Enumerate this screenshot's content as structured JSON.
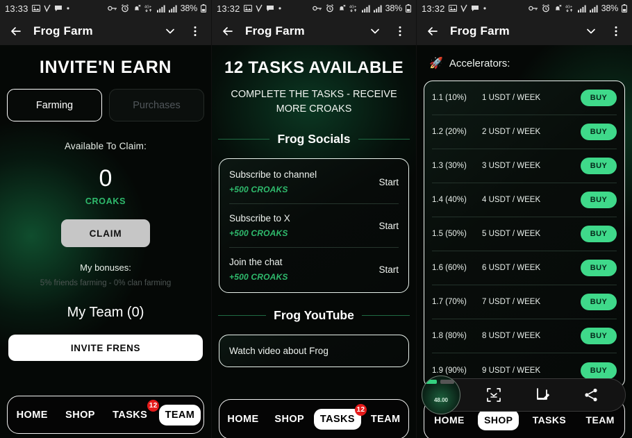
{
  "statusbar": {
    "time_1": "13:33",
    "time_2": "13:32",
    "time_3": "13:32",
    "battery": "38%",
    "left_icons": [
      "image-icon",
      "v-icon",
      "chat-icon",
      "dot-icon"
    ],
    "right_icons": [
      "vpn-key-icon",
      "alarm-icon",
      "bell-muted-icon",
      "data-4g-icon",
      "signal-bars-icon",
      "signal-bars-2-icon",
      "battery-icon"
    ]
  },
  "appbar": {
    "title": "Frog Farm",
    "back_icon": "arrow-back-icon",
    "chevron_icon": "chevron-down-icon",
    "overflow_icon": "more-vertical-icon"
  },
  "panel1": {
    "title": "INVITE'N EARN",
    "tabs": [
      {
        "label": "Farming",
        "active": true
      },
      {
        "label": "Purchases",
        "active": false
      }
    ],
    "available_label": "Available To Claim:",
    "available_value": "0",
    "currency": "CROAKS",
    "claim_button": "CLAIM",
    "bonuses_label": "My bonuses:",
    "bonuses_detail": "5% friends farming - 0% clan farming",
    "team_heading": "My Team (0)",
    "invite_button": "INVITE FRENS",
    "nav": [
      {
        "label": "HOME",
        "active": false,
        "badge": ""
      },
      {
        "label": "SHOP",
        "active": false,
        "badge": ""
      },
      {
        "label": "TASKS",
        "active": false,
        "badge": "12"
      },
      {
        "label": "TEAM",
        "active": true,
        "badge": ""
      }
    ]
  },
  "panel2": {
    "title": "12 TASKS AVAILABLE",
    "subtitle": "COMPLETE THE TASKS - RECEIVE MORE CROAKS",
    "sections": [
      {
        "heading": "Frog Socials",
        "tasks": [
          {
            "name": "Subscribe to channel",
            "reward": "+500 CROAKS",
            "action": "Start"
          },
          {
            "name": "Subscribe to X",
            "reward": "+500 CROAKS",
            "action": "Start"
          },
          {
            "name": "Join the chat",
            "reward": "+500 CROAKS",
            "action": "Start"
          }
        ]
      },
      {
        "heading": "Frog YouTube",
        "tasks": [
          {
            "name": "Watch video about Frog",
            "reward": "",
            "action": ""
          }
        ]
      }
    ],
    "nav": [
      {
        "label": "HOME",
        "active": false,
        "badge": ""
      },
      {
        "label": "SHOP",
        "active": false,
        "badge": ""
      },
      {
        "label": "TASKS",
        "active": true,
        "badge": "12"
      },
      {
        "label": "TEAM",
        "active": false,
        "badge": ""
      }
    ]
  },
  "panel3": {
    "heading": "Accelerators:",
    "heading_icon": "rocket-icon",
    "rows": [
      {
        "level": "1.1 (10%)",
        "price": "1 USDT / WEEK",
        "action": "BUY"
      },
      {
        "level": "1.2 (20%)",
        "price": "2 USDT / WEEK",
        "action": "BUY"
      },
      {
        "level": "1.3 (30%)",
        "price": "3 USDT / WEEK",
        "action": "BUY"
      },
      {
        "level": "1.4 (40%)",
        "price": "4 USDT / WEEK",
        "action": "BUY"
      },
      {
        "level": "1.5 (50%)",
        "price": "5 USDT / WEEK",
        "action": "BUY"
      },
      {
        "level": "1.6 (60%)",
        "price": "6 USDT / WEEK",
        "action": "BUY"
      },
      {
        "level": "1.7 (70%)",
        "price": "7 USDT / WEEK",
        "action": "BUY"
      },
      {
        "level": "1.8 (80%)",
        "price": "8 USDT / WEEK",
        "action": "BUY"
      },
      {
        "level": "1.9 (90%)",
        "price": "9 USDT / WEEK",
        "action": "BUY"
      }
    ],
    "screenshot_toolbar": {
      "thumbnail_value": "48.00",
      "icons": [
        "crop-expand-icon",
        "markup-edit-icon",
        "share-icon"
      ]
    },
    "nav": [
      {
        "label": "HOME",
        "active": false,
        "badge": ""
      },
      {
        "label": "SHOP",
        "active": true,
        "badge": ""
      },
      {
        "label": "TASKS",
        "active": false,
        "badge": ""
      },
      {
        "label": "TEAM",
        "active": false,
        "badge": ""
      }
    ]
  },
  "colors": {
    "accent_green": "#2fbb6d",
    "buy_green": "#3fd98a",
    "badge_red": "#e41b1b",
    "background": "#050806"
  }
}
